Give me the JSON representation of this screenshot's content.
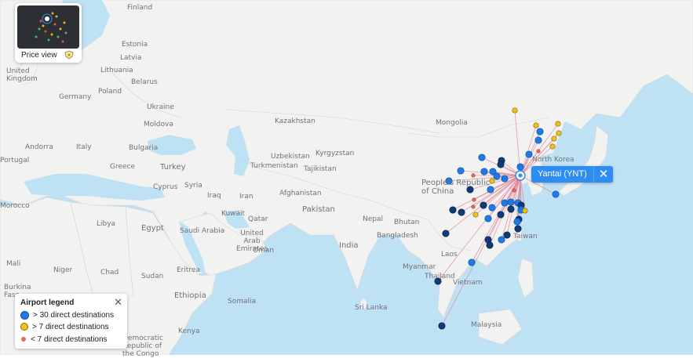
{
  "price_view": {
    "label": "Price view",
    "icon": "price-tag-icon"
  },
  "selected_airport": {
    "label": "Yantai (YNT)",
    "close_icon": "close-icon"
  },
  "legend": {
    "title": "Airport legend",
    "close_icon": "close-icon",
    "items": [
      {
        "label": "> 30 direct destinations",
        "color": "#1e7be6"
      },
      {
        "label": "> 7 direct destinations",
        "color": "#f2c21b"
      },
      {
        "label": "< 7 direct destinations",
        "color": "#e86b5b"
      }
    ]
  },
  "colors": {
    "route_line": "#e07f95",
    "dark_airport": "#103a78",
    "land": "#f2f2f0",
    "water": "#bfe1f4"
  },
  "country_labels": [
    "Finland",
    "Estonia",
    "Latvia",
    "Lithuania",
    "United Kingdom",
    "Belarus",
    "Poland",
    "Germany",
    "Ukraine",
    "Moldova",
    "Andorra",
    "Italy",
    "Bulgaria",
    "Greece",
    "Turkey",
    "Cyprus",
    "Syria",
    "Iraq",
    "Iran",
    "Kuwait",
    "Saudi Arabia",
    "United Arab Emirates",
    "Oman",
    "Qatar",
    "Egypt",
    "Libya",
    "Chad",
    "Sudan",
    "Eritrea",
    "Ethiopia",
    "Kenya",
    "Niger",
    "Burkina Faso",
    "Morocco",
    "Mali",
    "Kazakhstan",
    "Uzbekistan",
    "Kyrgyzstan",
    "Turkmenistan",
    "Tajikistan",
    "Afghanistan",
    "Pakistan",
    "India",
    "Nepal",
    "Bhutan",
    "Bangladesh",
    "Myanmar",
    "Laos",
    "Thailand",
    "Vietnam",
    "Mongolia",
    "People's Republic of China",
    "North Korea",
    "Sri Lanka",
    "Malaysia",
    "Taiwan",
    "Portugal",
    "Democratic Republic of the Congo",
    "Somalia"
  ]
}
